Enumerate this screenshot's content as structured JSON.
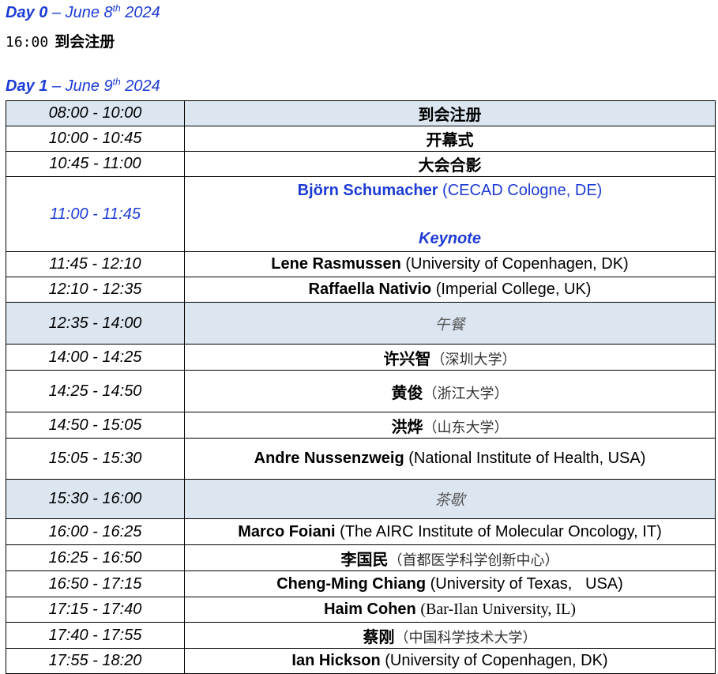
{
  "day0": {
    "label": "Day 0",
    "date_prefix": "– June 8",
    "date_sup": "th",
    "year": "2024",
    "time": "16:00",
    "content": "到会注册"
  },
  "day1": {
    "label": "Day 1",
    "date_prefix": "– June 9",
    "date_sup": "th",
    "year": "2024"
  },
  "rows": [
    {
      "time": "08:00 - 10:00",
      "title": "到会注册"
    },
    {
      "time": "10:00 - 10:45",
      "title": "开幕式"
    },
    {
      "time": "10:45 - 11:00",
      "title": "大会合影"
    },
    {
      "time": "11:00 - 11:45",
      "speaker": "Björn Schumacher",
      "affiliation": "(CECAD Cologne, DE)",
      "tag": "Keynote"
    },
    {
      "time": "11:45 - 12:10",
      "speaker": "Lene Rasmussen",
      "affiliation": "(University of Copenhagen, DK)"
    },
    {
      "time": "12:10 - 12:35",
      "speaker": "Raffaella Nativio",
      "affiliation": "(Imperial College, UK)"
    },
    {
      "time": "12:35 - 14:00",
      "break": "午餐"
    },
    {
      "time": "14:00 - 14:25",
      "speaker": "许兴智",
      "affiliation": "（深圳大学）"
    },
    {
      "time": "14:25 - 14:50",
      "speaker": "黄俊",
      "affiliation": "（浙江大学）"
    },
    {
      "time": "14:50 - 15:05",
      "speaker": "洪烨",
      "affiliation": "（山东大学）"
    },
    {
      "time": "15:05 - 15:30",
      "speaker": "Andre Nussenzweig",
      "affiliation": "(National Institute of Health, USA)"
    },
    {
      "time": "15:30 - 16:00",
      "break": "茶歇"
    },
    {
      "time": "16:00 - 16:25",
      "speaker": "Marco Foiani",
      "affiliation": "(The AIRC Institute of Molecular Oncology, IT)"
    },
    {
      "time": "16:25 - 16:50",
      "speaker": "李国民",
      "affiliation": "（首都医学科学创新中心）"
    },
    {
      "time": "16:50 - 17:15",
      "speaker": "Cheng-Ming Chiang",
      "affiliation": "(University of Texas,   USA)"
    },
    {
      "time": "17:15 - 17:40",
      "speaker": "Haim Cohen",
      "affiliation": "(Bar-Ilan University, IL)"
    },
    {
      "time": "17:40 - 17:55",
      "speaker": "蔡刚",
      "affiliation": "（中国科学技术大学）"
    },
    {
      "time": "17:55 - 18:20",
      "speaker": "Ian Hickson",
      "affiliation": "(University of Copenhagen, DK)"
    }
  ]
}
